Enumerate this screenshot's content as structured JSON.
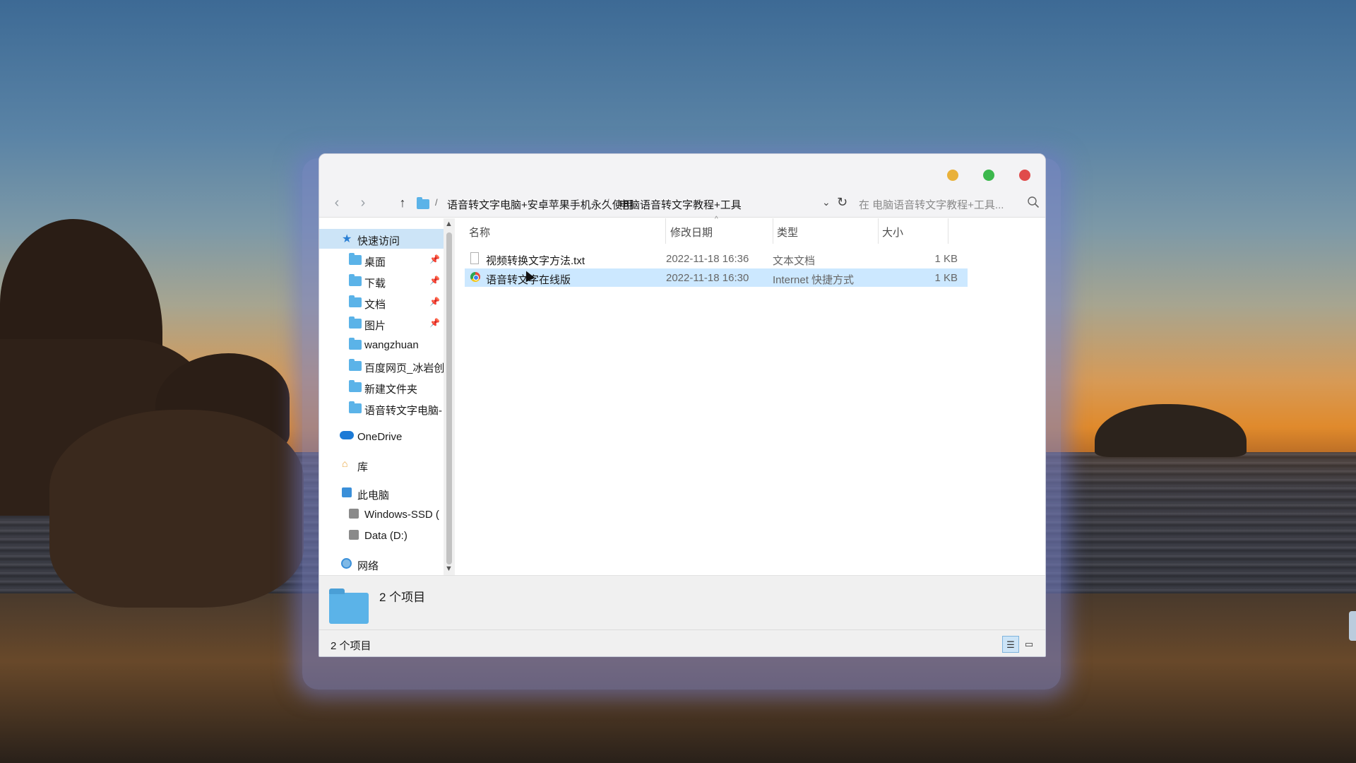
{
  "window": {
    "breadcrumb": [
      "语音转文字电脑+安卓苹果手机永久使用",
      "电脑语音转文字教程+工具"
    ],
    "search_placeholder": "在 电脑语音转文字教程+工具..."
  },
  "sidebar": {
    "quick_access": "快速访问",
    "items": [
      {
        "label": "桌面",
        "pinned": true
      },
      {
        "label": "下载",
        "pinned": true
      },
      {
        "label": "文档",
        "pinned": true
      },
      {
        "label": "图片",
        "pinned": true
      },
      {
        "label": "wangzhuan",
        "pinned": false
      },
      {
        "label": "百度网页_冰岩创",
        "pinned": false
      },
      {
        "label": "新建文件夹",
        "pinned": false
      },
      {
        "label": "语音转文字电脑-",
        "pinned": false
      }
    ],
    "onedrive": "OneDrive",
    "library": "库",
    "this_pc": "此电脑",
    "drives": [
      "Windows-SSD (",
      "Data (D:)"
    ],
    "network": "网络"
  },
  "columns": {
    "name": "名称",
    "date": "修改日期",
    "type": "类型",
    "size": "大小"
  },
  "files": [
    {
      "name": "视频转换文字方法.txt",
      "date": "2022-11-18 16:36",
      "type": "文本文档",
      "size": "1 KB",
      "icon": "text-file-icon"
    },
    {
      "name": "语音转文字在线版",
      "date": "2022-11-18 16:30",
      "type": "Internet 快捷方式",
      "size": "1 KB",
      "icon": "internet-shortcut-icon"
    }
  ],
  "details": {
    "count": "2 个项目"
  },
  "status": {
    "count": "2 个项目"
  },
  "colors": {
    "selection": "#cce8ff",
    "folder": "#5bb3e8",
    "close": "#e04b4b",
    "minimize": "#e9b13a",
    "maximize": "#3cb84d"
  }
}
